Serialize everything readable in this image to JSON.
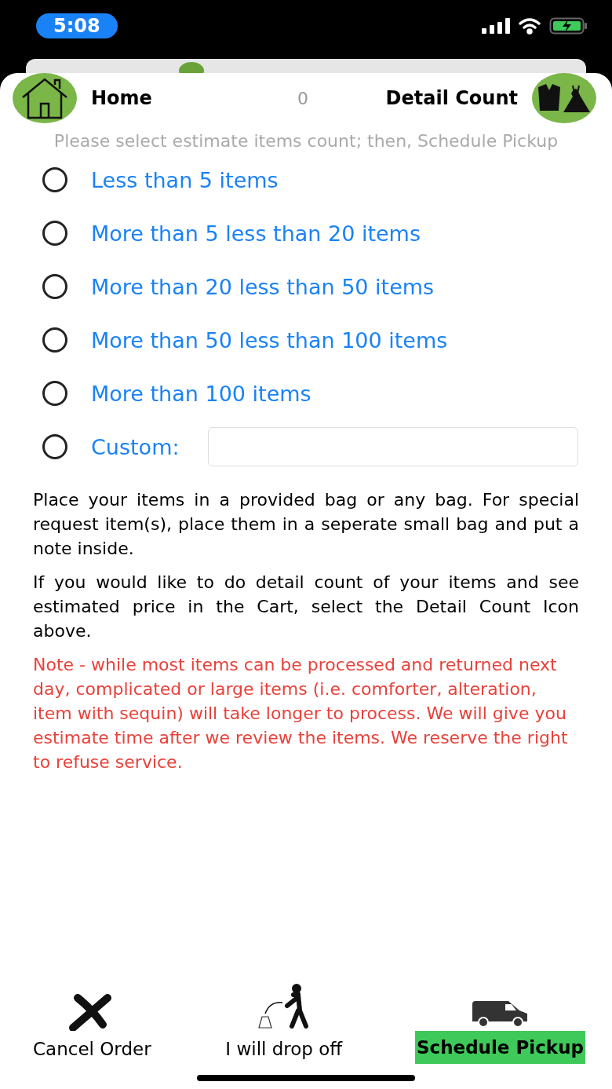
{
  "status_bar": {
    "time": "5:08"
  },
  "header": {
    "home_label": "Home",
    "count": "0",
    "detail_label": "Detail Count"
  },
  "instruction": "Please select estimate items count; then, Schedule Pickup",
  "options": [
    {
      "label": "Less than 5 items",
      "selected": false,
      "kind": "plain"
    },
    {
      "label": "More than 5 less than 20 items",
      "selected": false,
      "kind": "plain"
    },
    {
      "label": "More than 20 less than 50 items",
      "selected": false,
      "kind": "plain"
    },
    {
      "label": "More than 50 less than 100 items",
      "selected": false,
      "kind": "plain"
    },
    {
      "label": "More than 100 items",
      "selected": false,
      "kind": "plain"
    },
    {
      "label": "Custom:",
      "selected": false,
      "kind": "custom"
    }
  ],
  "paragraphs": [
    {
      "text": "Place your items in a provided bag or any bag. For special request item(s), place them in a seperate small bag and put a note inside.",
      "kind": "info"
    },
    {
      "text": "If you would like to do detail count of your items and see estimated price in the Cart, select the Detail Count Icon above.",
      "kind": "info"
    },
    {
      "text": "Note - while most items can be processed and returned next day, complicated or large items (i.e. comforter, alteration, item with sequin) will take longer to process.  We will give you estimate time after we review the items. We reserve the right to refuse service.",
      "kind": "note"
    }
  ],
  "actions": [
    {
      "label": "Cancel Order",
      "kind": "cancel",
      "selected": false
    },
    {
      "label": "I will drop off",
      "kind": "dropoff",
      "selected": false
    },
    {
      "label": "Schedule Pickup",
      "kind": "pickup",
      "selected": true
    }
  ]
}
